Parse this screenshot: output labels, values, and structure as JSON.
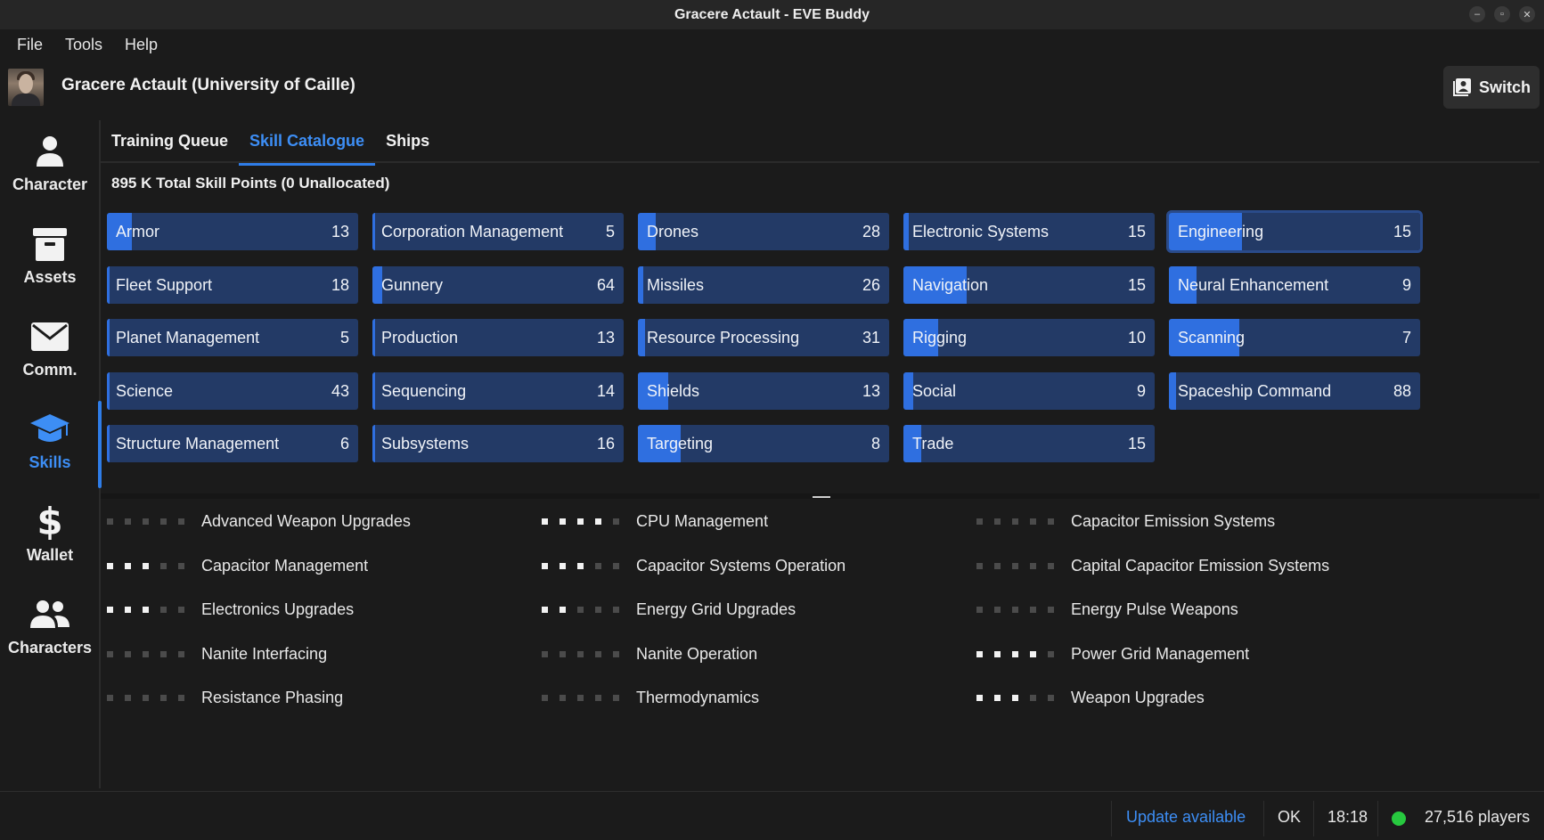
{
  "window": {
    "title": "Gracere Actault - EVE Buddy",
    "controls": [
      "minimize-icon",
      "restore-icon",
      "close-icon"
    ]
  },
  "menu": [
    "File",
    "Tools",
    "Help"
  ],
  "character": {
    "name": "Gracere Actault (University of Caille)",
    "switch_label": "Switch"
  },
  "sidebar": [
    {
      "label": "Character",
      "icon": "person-icon"
    },
    {
      "label": "Assets",
      "icon": "archive-box-icon"
    },
    {
      "label": "Comm.",
      "icon": "envelope-icon"
    },
    {
      "label": "Skills",
      "icon": "graduation-cap-icon",
      "active": true
    },
    {
      "label": "Wallet",
      "icon": "dollar-icon"
    },
    {
      "label": "Characters",
      "icon": "people-icon"
    }
  ],
  "tabs": [
    {
      "label": "Training Queue"
    },
    {
      "label": "Skill Catalogue",
      "active": true
    },
    {
      "label": "Ships"
    }
  ],
  "total_skill_points": "895 K Total Skill Points (0 Unallocated)",
  "categories": [
    {
      "name": "Armor",
      "count": "13",
      "progress": 0.1
    },
    {
      "name": "Corporation Management",
      "count": "5",
      "progress": 0.0
    },
    {
      "name": "Drones",
      "count": "28",
      "progress": 0.07
    },
    {
      "name": "Electronic Systems",
      "count": "15",
      "progress": 0.02
    },
    {
      "name": "Engineering",
      "count": "15",
      "progress": 0.29,
      "selected": true
    },
    {
      "name": "Fleet Support",
      "count": "18",
      "progress": 0.0
    },
    {
      "name": "Gunnery",
      "count": "64",
      "progress": 0.04
    },
    {
      "name": "Missiles",
      "count": "26",
      "progress": 0.02
    },
    {
      "name": "Navigation",
      "count": "15",
      "progress": 0.25
    },
    {
      "name": "Neural Enhancement",
      "count": "9",
      "progress": 0.11
    },
    {
      "name": "Planet Management",
      "count": "5",
      "progress": 0.0
    },
    {
      "name": "Production",
      "count": "13",
      "progress": 0.01
    },
    {
      "name": "Resource Processing",
      "count": "31",
      "progress": 0.03
    },
    {
      "name": "Rigging",
      "count": "10",
      "progress": 0.14
    },
    {
      "name": "Scanning",
      "count": "7",
      "progress": 0.28
    },
    {
      "name": "Science",
      "count": "43",
      "progress": 0.01
    },
    {
      "name": "Sequencing",
      "count": "14",
      "progress": 0.0
    },
    {
      "name": "Shields",
      "count": "13",
      "progress": 0.12
    },
    {
      "name": "Social",
      "count": "9",
      "progress": 0.04
    },
    {
      "name": "Spaceship Command",
      "count": "88",
      "progress": 0.03
    },
    {
      "name": "Structure Management",
      "count": "6",
      "progress": 0.0
    },
    {
      "name": "Subsystems",
      "count": "16",
      "progress": 0.0
    },
    {
      "name": "Targeting",
      "count": "8",
      "progress": 0.17
    },
    {
      "name": "Trade",
      "count": "15",
      "progress": 0.07
    }
  ],
  "skills": [
    {
      "name": "Advanced Weapon Upgrades",
      "level": 0
    },
    {
      "name": "CPU Management",
      "level": 4
    },
    {
      "name": "Capacitor Emission Systems",
      "level": 0
    },
    {
      "name": "Capacitor Management",
      "level": 3
    },
    {
      "name": "Capacitor Systems Operation",
      "level": 3
    },
    {
      "name": "Capital Capacitor Emission Systems",
      "level": 0
    },
    {
      "name": "Electronics Upgrades",
      "level": 3
    },
    {
      "name": "Energy Grid Upgrades",
      "level": 2
    },
    {
      "name": "Energy Pulse Weapons",
      "level": 0
    },
    {
      "name": "Nanite Interfacing",
      "level": 0
    },
    {
      "name": "Nanite Operation",
      "level": 0
    },
    {
      "name": "Power Grid Management",
      "level": 4
    },
    {
      "name": "Resistance Phasing",
      "level": 0
    },
    {
      "name": "Thermodynamics",
      "level": 0
    },
    {
      "name": "Weapon Upgrades",
      "level": 3
    }
  ],
  "status": {
    "update": "Update available",
    "server": "OK",
    "time": "18:18",
    "players": "27,516 players",
    "online_color": "#27c93f",
    "accent": "#3d8ef5"
  }
}
